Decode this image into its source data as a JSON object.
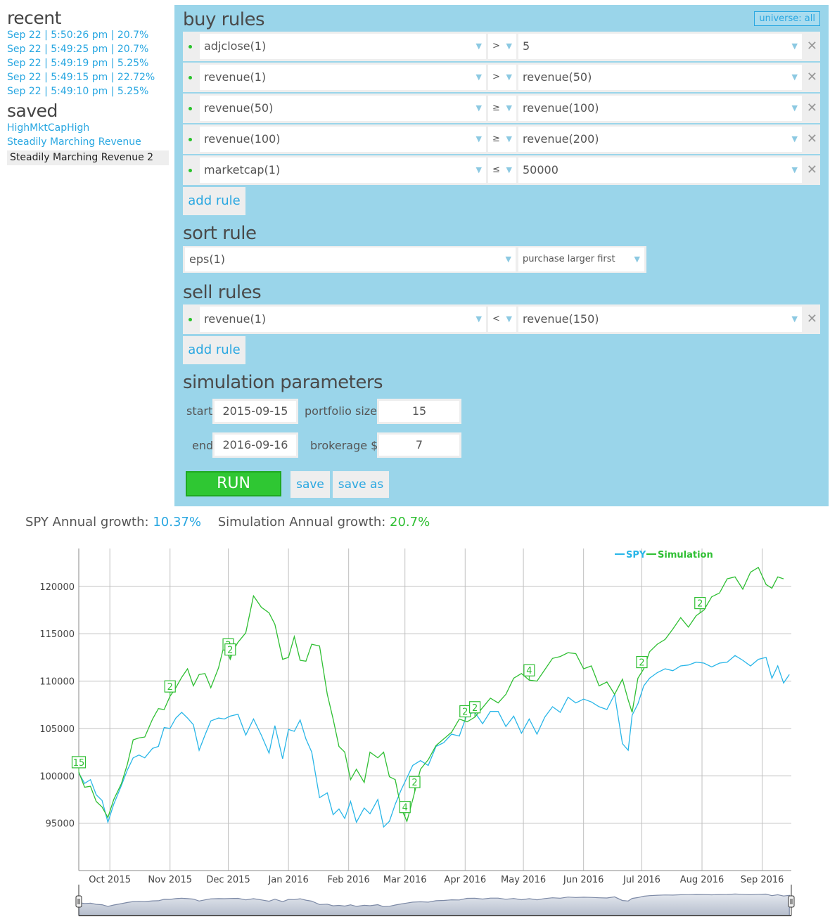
{
  "sidebar": {
    "recent_title": "recent",
    "recent": [
      "Sep 22 | 5:50:26 pm | 20.7%",
      "Sep 22 | 5:49:25 pm | 20.7%",
      "Sep 22 | 5:49:19 pm | 5.25%",
      "Sep 22 | 5:49:15 pm | 22.72%",
      "Sep 22 | 5:49:10 pm | 5.25%"
    ],
    "saved_title": "saved",
    "saved": [
      "HighMktCapHigh",
      "Steadily Marching Revenue"
    ],
    "selected": "Steadily Marching Revenue 2"
  },
  "buy": {
    "title": "buy rules",
    "universe": "universe: all",
    "rules": [
      {
        "left": "adjclose(1)",
        "op": ">",
        "right": "5"
      },
      {
        "left": "revenue(1)",
        "op": ">",
        "right": "revenue(50)"
      },
      {
        "left": "revenue(50)",
        "op": "≥",
        "right": "revenue(100)"
      },
      {
        "left": "revenue(100)",
        "op": "≥",
        "right": "revenue(200)"
      },
      {
        "left": "marketcap(1)",
        "op": "≤",
        "right": "50000"
      }
    ],
    "add_label": "add rule"
  },
  "sort": {
    "title": "sort rule",
    "field": "eps(1)",
    "order": "purchase larger first"
  },
  "sell": {
    "title": "sell rules",
    "rules": [
      {
        "left": "revenue(1)",
        "op": "<",
        "right": "revenue(150)"
      }
    ],
    "add_label": "add rule"
  },
  "sim": {
    "title": "simulation parameters",
    "start_label": "start",
    "start": "2015-09-15",
    "end_label": "end",
    "end": "2016-09-16",
    "portfolio_label": "portfolio size",
    "portfolio": "15",
    "brokerage_label": "brokerage $",
    "brokerage": "7",
    "run_label": "RUN",
    "save_label": "save",
    "save_as_label": "save as"
  },
  "growth": {
    "spy_label": "SPY Annual growth:",
    "spy_value": "10.37%",
    "sim_label": "Simulation Annual growth:",
    "sim_value": "20.7%"
  },
  "colors": {
    "spy": "#29b6e8",
    "sim": "#2fbf33",
    "accent": "#29a7e1",
    "panel": "#9ad5ea"
  },
  "chart_data": {
    "type": "line",
    "title": "",
    "xlabel": "",
    "ylabel": "",
    "ylim": [
      90000,
      124000
    ],
    "yticks": [
      95000,
      100000,
      105000,
      110000,
      115000,
      120000
    ],
    "xticks": [
      "Oct 2015",
      "Nov 2015",
      "Dec 2015",
      "Jan 2016",
      "Feb 2016",
      "Mar 2016",
      "Apr 2016",
      "May 2016",
      "Jun 2016",
      "Jul 2016",
      "Aug 2016",
      "Sep 2016"
    ],
    "xrange_days": [
      0,
      367
    ],
    "xtick_days": [
      16,
      47,
      77,
      108,
      139,
      168,
      199,
      229,
      260,
      290,
      321,
      352
    ],
    "legend": {
      "position": "top-right",
      "entries": [
        "SPY",
        "Simulation"
      ]
    },
    "grid": true,
    "series": [
      {
        "name": "SPY",
        "days": [
          0,
          3,
          6,
          9,
          12,
          15,
          18,
          22,
          25,
          28,
          31,
          34,
          38,
          41,
          44,
          47,
          50,
          53,
          56,
          59,
          62,
          65,
          68,
          72,
          75,
          78,
          82,
          86,
          90,
          94,
          98,
          101,
          105,
          108,
          111,
          114,
          117,
          120,
          124,
          128,
          131,
          134,
          137,
          140,
          143,
          147,
          150,
          154,
          157,
          160,
          163,
          166,
          169,
          172,
          176,
          180,
          184,
          188,
          192,
          196,
          200,
          204,
          208,
          212,
          216,
          220,
          224,
          228,
          232,
          236,
          240,
          244,
          248,
          252,
          256,
          260,
          264,
          268,
          272,
          276,
          280,
          283,
          285,
          288,
          291,
          294,
          298,
          302,
          306,
          310,
          314,
          318,
          322,
          326,
          330,
          334,
          338,
          342,
          346,
          350,
          354,
          357,
          360,
          363,
          366
        ],
        "values": [
          100300,
          99200,
          99600,
          98000,
          97400,
          95100,
          97000,
          99000,
          100600,
          101900,
          102200,
          101900,
          102900,
          103100,
          105100,
          105000,
          106100,
          106700,
          106100,
          105400,
          102700,
          104300,
          105800,
          106100,
          106000,
          106300,
          106500,
          104300,
          106000,
          104300,
          102400,
          105300,
          101800,
          104900,
          104700,
          105900,
          103900,
          102500,
          97700,
          98200,
          95900,
          96500,
          95500,
          97300,
          95100,
          96600,
          96000,
          97500,
          94600,
          95200,
          97000,
          98500,
          99800,
          101100,
          101600,
          101100,
          103100,
          103500,
          104400,
          104200,
          106500,
          106700,
          105500,
          106800,
          106800,
          105200,
          106300,
          104500,
          106000,
          104400,
          106200,
          107300,
          106700,
          108300,
          107700,
          108100,
          107800,
          107300,
          107000,
          108600,
          103400,
          102700,
          106400,
          107600,
          109500,
          110300,
          110900,
          111300,
          111100,
          111600,
          111700,
          112000,
          111900,
          111500,
          111900,
          112000,
          112700,
          112200,
          111600,
          112300,
          112500,
          110300,
          111600,
          109800,
          110700
        ]
      },
      {
        "name": "Simulation",
        "days": [
          0,
          3,
          6,
          9,
          12,
          15,
          18,
          22,
          25,
          28,
          31,
          34,
          38,
          41,
          44,
          47,
          50,
          53,
          56,
          59,
          62,
          65,
          68,
          72,
          75,
          78,
          80,
          82,
          86,
          90,
          94,
          98,
          101,
          105,
          108,
          111,
          114,
          117,
          120,
          124,
          128,
          131,
          134,
          137,
          140,
          143,
          147,
          150,
          154,
          157,
          160,
          163,
          166,
          169,
          172,
          176,
          180,
          184,
          188,
          192,
          196,
          200,
          204,
          208,
          212,
          216,
          220,
          224,
          228,
          232,
          236,
          240,
          244,
          248,
          252,
          256,
          260,
          264,
          268,
          272,
          276,
          280,
          283,
          285,
          288,
          291,
          294,
          298,
          302,
          306,
          310,
          314,
          318,
          322,
          326,
          330,
          334,
          338,
          342,
          346,
          350,
          354,
          357,
          360,
          363,
          366
        ],
        "values": [
          100400,
          98800,
          98900,
          97300,
          96700,
          95600,
          97500,
          99200,
          101200,
          103800,
          104000,
          104100,
          106000,
          107100,
          107000,
          108400,
          109300,
          110400,
          111300,
          109500,
          110700,
          110800,
          109300,
          111400,
          113900,
          112300,
          113400,
          114100,
          115100,
          119000,
          117800,
          117200,
          116000,
          112300,
          112500,
          114700,
          112200,
          112100,
          113900,
          113700,
          108600,
          106000,
          103100,
          102500,
          99600,
          100700,
          99300,
          102500,
          101900,
          102500,
          99900,
          99600,
          96600,
          95200,
          97500,
          100700,
          101700,
          103200,
          103900,
          104600,
          106000,
          105700,
          106200,
          107200,
          108200,
          107700,
          108600,
          110300,
          110800,
          110100,
          110000,
          111200,
          112400,
          112600,
          113000,
          112900,
          111300,
          111600,
          109500,
          109900,
          108600,
          110200,
          108000,
          106700,
          110300,
          111300,
          113100,
          113900,
          114400,
          115500,
          116700,
          115700,
          116900,
          117500,
          118900,
          119300,
          120800,
          121000,
          119700,
          121500,
          122000,
          120200,
          119800,
          121000,
          120800
        ]
      }
    ],
    "annotations": [
      {
        "series": "Simulation",
        "day": 0,
        "text": "15"
      },
      {
        "series": "Simulation",
        "day": 77,
        "text": "2"
      },
      {
        "series": "Simulation",
        "day": 78,
        "text": "2"
      },
      {
        "series": "Simulation",
        "day": 47,
        "text": "2"
      },
      {
        "series": "Simulation",
        "day": 168,
        "text": "4"
      },
      {
        "series": "Simulation",
        "day": 173,
        "text": "2"
      },
      {
        "series": "Simulation",
        "day": 199,
        "text": "2"
      },
      {
        "series": "Simulation",
        "day": 204,
        "text": "2"
      },
      {
        "series": "Simulation",
        "day": 232,
        "text": "4"
      },
      {
        "series": "Simulation",
        "day": 290,
        "text": "2"
      },
      {
        "series": "Simulation",
        "day": 320,
        "text": "2"
      }
    ]
  }
}
